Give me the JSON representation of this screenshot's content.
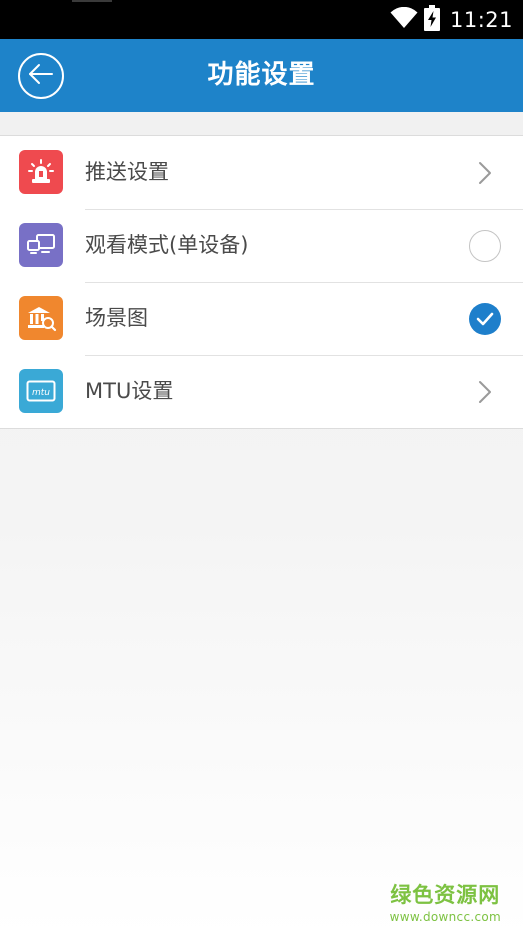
{
  "status_bar": {
    "time": "11:21",
    "icons": [
      "wifi-icon",
      "battery-charging-icon"
    ]
  },
  "header": {
    "title": "功能设置",
    "back_icon": "arrow-left-icon"
  },
  "settings": {
    "items": [
      {
        "label": "推送设置",
        "icon": "siren-alarm-icon",
        "icon_color": "#ef4a4f",
        "accessory": "chevron-right"
      },
      {
        "label": "观看模式(单设备)",
        "icon": "devices-icon",
        "icon_color": "#7870c6",
        "accessory": "radio-unchecked"
      },
      {
        "label": "场景图",
        "icon": "building-map-icon",
        "icon_color": "#f0872e",
        "accessory": "radio-checked"
      },
      {
        "label": "MTU设置",
        "icon": "mtu-icon",
        "icon_color": "#3aa9d6",
        "icon_text": "mtu",
        "accessory": "chevron-right"
      }
    ]
  },
  "watermark": {
    "title": "绿色资源网",
    "url": "www.downcc.com",
    "color": "#7dc242"
  },
  "colors": {
    "app_bar": "#1e83c9",
    "checked": "#1e7fcb"
  }
}
